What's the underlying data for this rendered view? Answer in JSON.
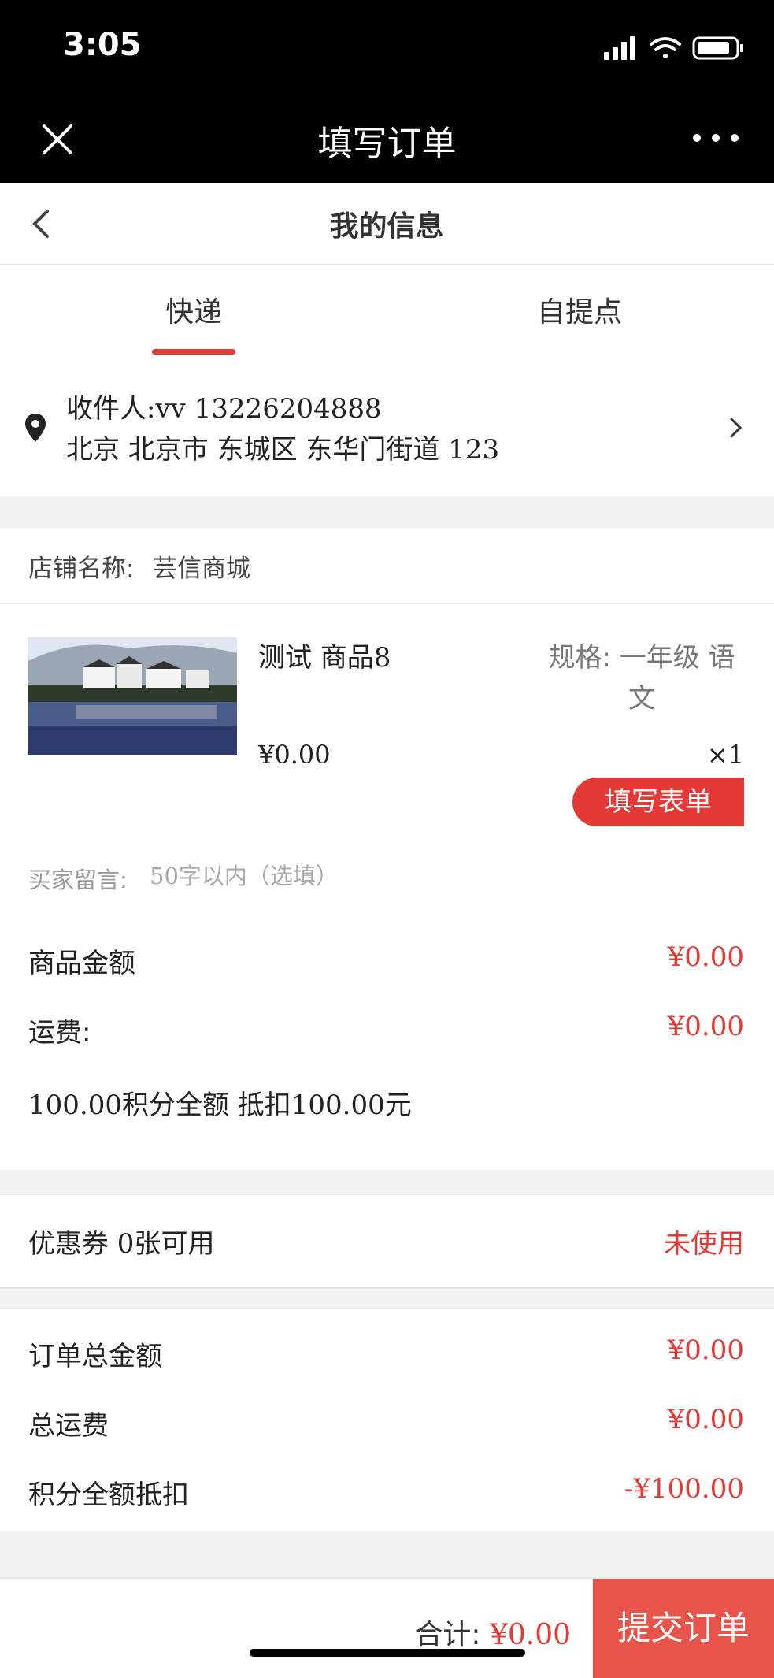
{
  "status": {
    "time": "3:05"
  },
  "nav": {
    "title": "填写订单"
  },
  "subheader": {
    "title": "我的信息"
  },
  "tabs": [
    {
      "label": "快递",
      "active": true
    },
    {
      "label": "自提点",
      "active": false
    }
  ],
  "address": {
    "recipient": "收件人:vv 13226204888",
    "detail": "北京 北京市 东城区 东华门街道 123"
  },
  "shop": {
    "label": "店铺名称:",
    "name": "芸信商城"
  },
  "product": {
    "name": "测试 商品8",
    "spec": "规格: 一年级 语文",
    "price": "¥0.00",
    "qty": "×1",
    "form_button": "填写表单"
  },
  "note": {
    "label": "买家留言:",
    "placeholder": "50字以内（选填）"
  },
  "fees": {
    "goods_label": "商品金额",
    "goods_value": "¥0.00",
    "shipping_label": "运费:",
    "shipping_value": "¥0.00",
    "points_text": "100.00积分全额 抵扣100.00元"
  },
  "coupon": {
    "label": "优惠券 0张可用",
    "status": "未使用"
  },
  "summary": {
    "order_total_label": "订单总金额",
    "order_total_value": "¥0.00",
    "total_shipping_label": "总运费",
    "total_shipping_value": "¥0.00",
    "points_deduct_label": "积分全额抵扣",
    "points_deduct_value": "-¥100.00"
  },
  "bottom": {
    "total_label": "合计:",
    "total_value": "¥0.00",
    "submit_label": "提交订单"
  },
  "colors": {
    "accent": "#e53935",
    "submit_bg": "#e8544a"
  }
}
